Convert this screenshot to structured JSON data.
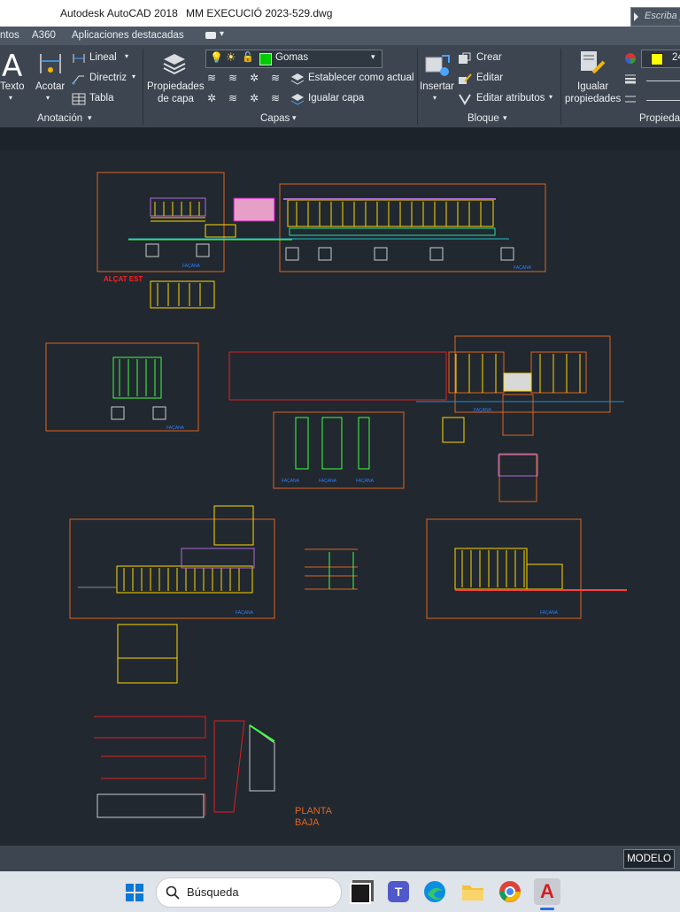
{
  "window": {
    "app_title": "Autodesk AutoCAD 2018",
    "file_name": "MM EXECUCIÓ 2023-529.dwg",
    "search_placeholder": "Escriba p"
  },
  "ribbon_tabs": [
    "ntos",
    "A360",
    "Aplicaciones destacadas"
  ],
  "ribbon": {
    "anotacion": {
      "texto_label": "Texto",
      "acotar_label": "Acotar",
      "lineal_label": "Lineal",
      "directriz_label": "Directriz",
      "tabla_label": "Tabla",
      "panel_title": "Anotación"
    },
    "capas": {
      "propiedades_label_1": "Propiedades",
      "propiedades_label_2": "de capa",
      "current_layer": "Gomas",
      "current_layer_color": "#00cc00",
      "establecer_label": "Establecer como actual",
      "igualar_capa_label": "Igualar capa",
      "panel_title": "Capas"
    },
    "bloque": {
      "insertar_label": "Insertar",
      "crear_label": "Crear",
      "editar_label": "Editar",
      "editar_atributos_label": "Editar atributos",
      "panel_title": "Bloque"
    },
    "propiedades": {
      "igualar_label_1": "Igualar",
      "igualar_label_2": "propiedades",
      "color_value": "24",
      "color_swatch": "#ffff00",
      "panel_title": "Propiedad"
    }
  },
  "drawing": {
    "label_alcat_est": "ALÇAT EST",
    "label_planta_1": "PLANTA",
    "label_planta_2": "BAJA",
    "label_facana": "FAÇANA"
  },
  "status": {
    "modelo_label": "MODELO"
  },
  "taskbar": {
    "search_label": "Búsqueda"
  }
}
